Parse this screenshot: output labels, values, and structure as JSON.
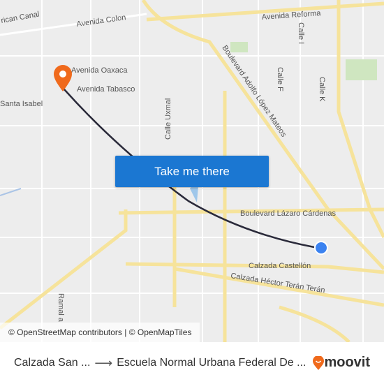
{
  "map": {
    "street_labels": {
      "american_canal": "rican Canal",
      "avenida_colon": "Avenida Colon",
      "avenida_reforma": "Avenida Reforma",
      "calle_i": "Calle I",
      "blvd_lopez_mateos": "Boulevard Adolfo López Mateos",
      "calle_f": "Calle F",
      "calle_k": "Calle K",
      "avenida_oaxaca": "Avenida Oaxaca",
      "avenida_tabasco": "Avenida Tabasco",
      "santa_isabel": "Santa Isabel",
      "calle_uxmal": "Calle Uxmal",
      "blvd_lazaro_cardenas": "Boulevard Lázaro Cárdenas",
      "calzada_castellon": "Calzada Castellón",
      "calzada_hector_teran": "Calzada Héctor Terán Terán",
      "ramal": "Ramal a"
    },
    "colors": {
      "background": "#ededed",
      "major_road": "#f6e39b",
      "route": "#2a2a3a",
      "origin": "#3b82f0",
      "destination": "#f06a1c",
      "button": "#1b77d2"
    },
    "attribution": "© OpenStreetMap contributors | © OpenMapTiles",
    "cta_label": "Take me there"
  },
  "footer": {
    "origin": "Calzada San ...",
    "destination": "Escuela Normal Urbana Federal De ...",
    "brand": "moovit"
  }
}
